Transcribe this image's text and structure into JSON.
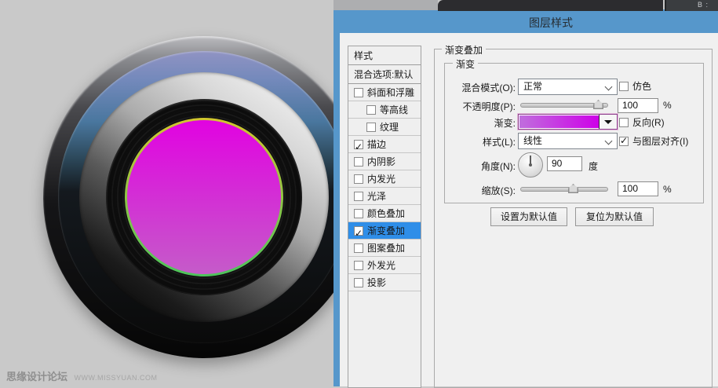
{
  "topbar": {
    "right_text": "B :"
  },
  "dialog": {
    "title": "图层样式",
    "styles_panel": {
      "header": "样式",
      "blending_label": "混合选项:默认",
      "items": [
        {
          "label": "斜面和浮雕",
          "checked": false,
          "selected": false,
          "indent": false
        },
        {
          "label": "等高线",
          "checked": false,
          "selected": false,
          "indent": true
        },
        {
          "label": "纹理",
          "checked": false,
          "selected": false,
          "indent": true
        },
        {
          "label": "描边",
          "checked": true,
          "selected": false,
          "indent": false
        },
        {
          "label": "内阴影",
          "checked": false,
          "selected": false,
          "indent": false
        },
        {
          "label": "内发光",
          "checked": false,
          "selected": false,
          "indent": false
        },
        {
          "label": "光泽",
          "checked": false,
          "selected": false,
          "indent": false
        },
        {
          "label": "颜色叠加",
          "checked": false,
          "selected": false,
          "indent": false
        },
        {
          "label": "渐变叠加",
          "checked": true,
          "selected": true,
          "indent": false
        },
        {
          "label": "图案叠加",
          "checked": false,
          "selected": false,
          "indent": false
        },
        {
          "label": "外发光",
          "checked": false,
          "selected": false,
          "indent": false
        },
        {
          "label": "投影",
          "checked": false,
          "selected": false,
          "indent": false
        }
      ]
    },
    "settings": {
      "section_title": "渐变叠加",
      "group_title": "渐变",
      "blend_mode_label": "混合模式(O):",
      "blend_mode_value": "正常",
      "dither_label": "仿色",
      "dither_checked": false,
      "opacity_label": "不透明度(P):",
      "opacity_value": "100",
      "opacity_unit": "%",
      "gradient_label": "渐变:",
      "gradient_start_color": "#c06edd",
      "gradient_end_color": "#ce00e8",
      "reverse_label": "反向(R)",
      "reverse_checked": false,
      "style_label": "样式(L):",
      "style_value": "线性",
      "align_label": "与图层对齐(I)",
      "align_checked": true,
      "angle_label": "角度(N):",
      "angle_value": "90",
      "angle_unit": "度",
      "scale_label": "缩放(S):",
      "scale_value": "100",
      "scale_unit": "%",
      "set_default_button": "设置为默认值",
      "reset_default_button": "复位为默认值"
    }
  },
  "lens": {
    "glass_top_color": "#e103e1",
    "glass_bottom_color": "#c55bc9",
    "ring_top_color": "#d2c52f",
    "ring_bottom_color": "#4dc35c"
  },
  "watermark": {
    "site": "思缘设计论坛",
    "url": "WWW.MISSYUAN.COM"
  }
}
